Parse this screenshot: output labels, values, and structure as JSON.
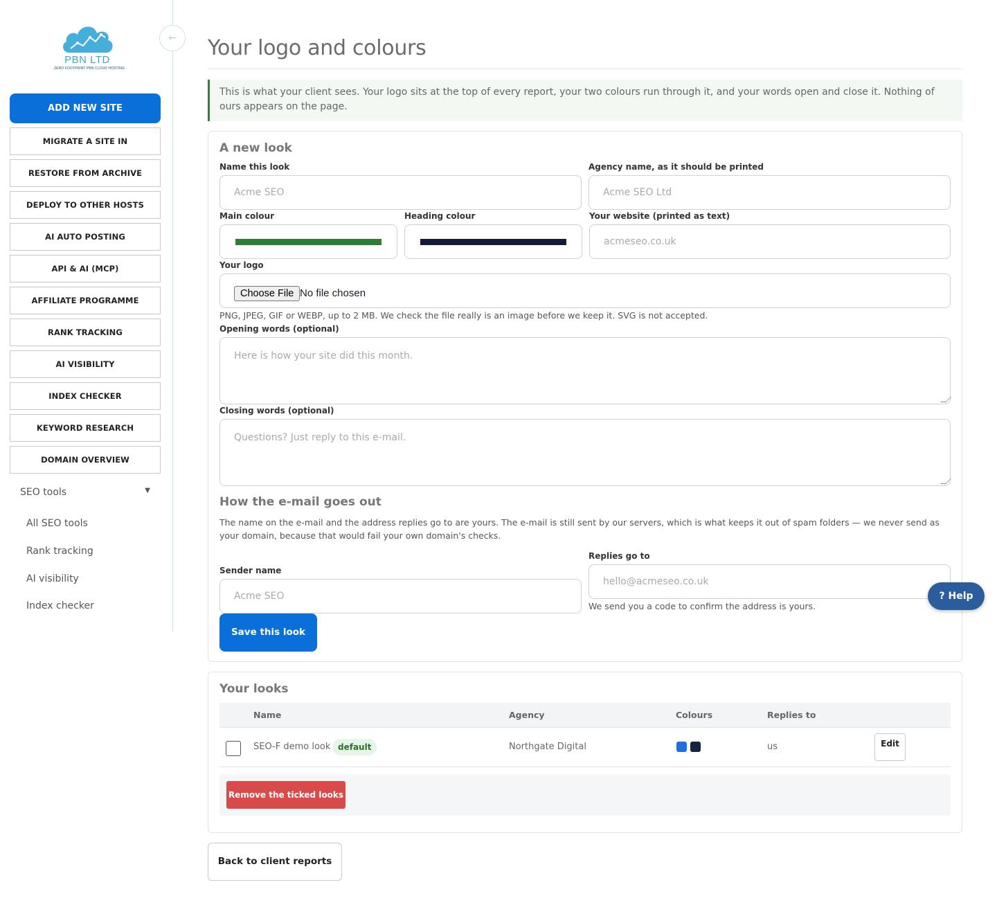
{
  "brand": {
    "name": "PBN LTD",
    "tagline": "ZERO FOOTPRINT PBN CLOUD HOSTING",
    "logo_color": "#3aa6d6"
  },
  "sidebar": {
    "collapse_icon": "←",
    "primary_button": "ADD NEW SITE",
    "buttons": [
      "MIGRATE A SITE IN",
      "RESTORE FROM ARCHIVE",
      "DEPLOY TO OTHER HOSTS",
      "AI AUTO POSTING",
      "API & AI (MCP)",
      "AFFILIATE PROGRAMME",
      "RANK TRACKING",
      "AI VISIBILITY",
      "INDEX CHECKER",
      "KEYWORD RESEARCH",
      "DOMAIN OVERVIEW"
    ],
    "seo_tools_label": "SEO tools",
    "seo_tools_caret": "▼",
    "seo_tools_items": [
      "All SEO tools",
      "Rank tracking",
      "AI visibility",
      "Index checker"
    ]
  },
  "page": {
    "title": "Your logo and colours",
    "notice": "This is what your client sees. Your logo sits at the top of every report, your two colours run through it, and your words open and close it. Nothing of ours appears on the page."
  },
  "form": {
    "heading": "A new look",
    "name_label": "Name this look",
    "name_placeholder": "Acme SEO",
    "agency_label": "Agency name, as it should be printed",
    "agency_placeholder": "Acme SEO Ltd",
    "main_colour_label": "Main colour",
    "main_colour_value": "#2e7d32",
    "heading_colour_label": "Heading colour",
    "heading_colour_value": "#15193a",
    "website_label": "Your website (printed as text)",
    "website_placeholder": "acmeseo.co.uk",
    "logo_label": "Your logo",
    "choose_file": "Choose File",
    "no_file": "No file chosen",
    "logo_hint": "PNG, JPEG, GIF or WEBP, up to 2 MB. We check the file really is an image before we keep it. SVG is not accepted.",
    "opening_label": "Opening words (optional)",
    "opening_placeholder": "Here is how your site did this month.",
    "closing_label": "Closing words (optional)",
    "closing_placeholder": "Questions? Just reply to this e-mail.",
    "email_heading": "How the e-mail goes out",
    "email_text": "The name on the e-mail and the address replies go to are yours. The e-mail is still sent by our servers, which is what keeps it out of spam folders — we never send as your domain, because that would fail your own domain's checks.",
    "sender_label": "Sender name",
    "sender_placeholder": "Acme SEO",
    "replies_label": "Replies go to",
    "replies_placeholder": "hello@acmeseo.co.uk",
    "replies_hint": "We send you a code to confirm the address is yours.",
    "save_button": "Save this look"
  },
  "looks": {
    "heading": "Your looks",
    "columns": [
      "Name",
      "Agency",
      "Colours",
      "Replies to"
    ],
    "rows": [
      {
        "name": "SEO-F demo look",
        "badge": "default",
        "agency": "Northgate Digital",
        "colours": [
          "#1f6fe0",
          "#15233f"
        ],
        "replies_to": "us",
        "edit": "Edit"
      }
    ],
    "remove_button": "Remove the ticked looks"
  },
  "back_button": "Back to client reports",
  "help_button": "? Help"
}
